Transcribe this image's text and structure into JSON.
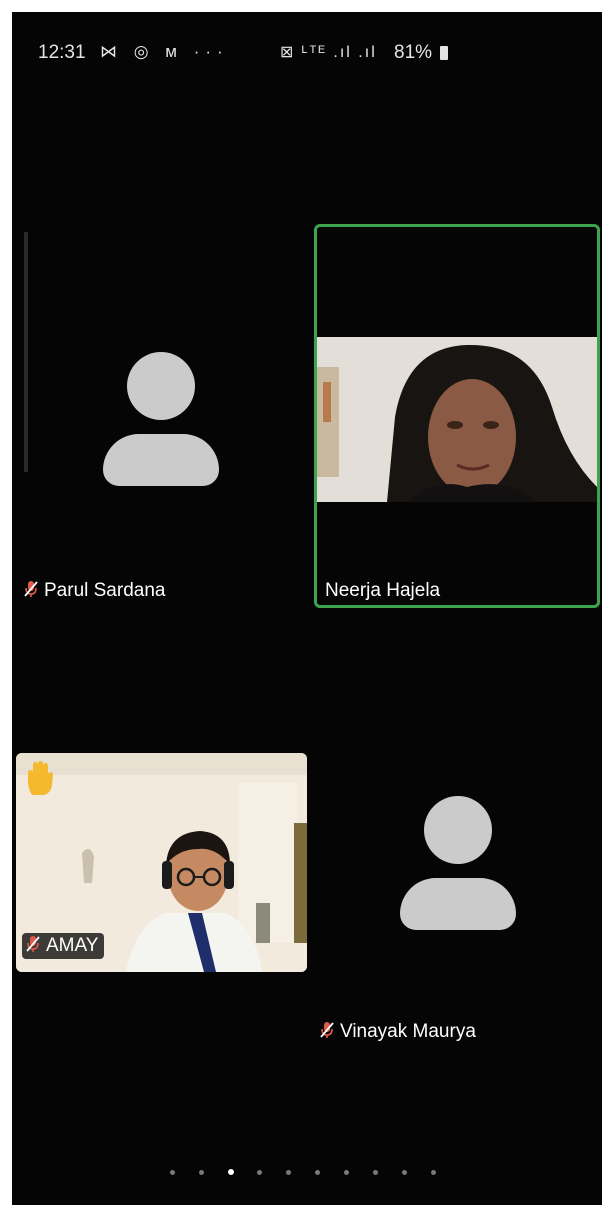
{
  "status_bar": {
    "time": "12:31",
    "left_icons": "⋈ ◎ ᴍ ···",
    "right_icons": "⊠ ᴸᵀᴱ .ıl .ıl",
    "battery": "81%"
  },
  "participants": [
    {
      "name": "Parul Sardana",
      "muted": true,
      "video": false,
      "active_speaker": false
    },
    {
      "name": "Neerja Hajela",
      "muted": false,
      "video": true,
      "active_speaker": true
    },
    {
      "name": "AMAY",
      "muted": true,
      "video": true,
      "hand_raised": true,
      "active_speaker": false
    },
    {
      "name": "Vinayak Maurya",
      "muted": true,
      "video": false,
      "active_speaker": false
    }
  ],
  "pagination": {
    "total_pages": 10,
    "current_page": 3
  },
  "colors": {
    "active_border": "#3fa34d",
    "background": "#050505",
    "avatar": "#cbcbcb",
    "muted_icon": "#e05a4c",
    "hand_icon": "#f5b92e"
  }
}
